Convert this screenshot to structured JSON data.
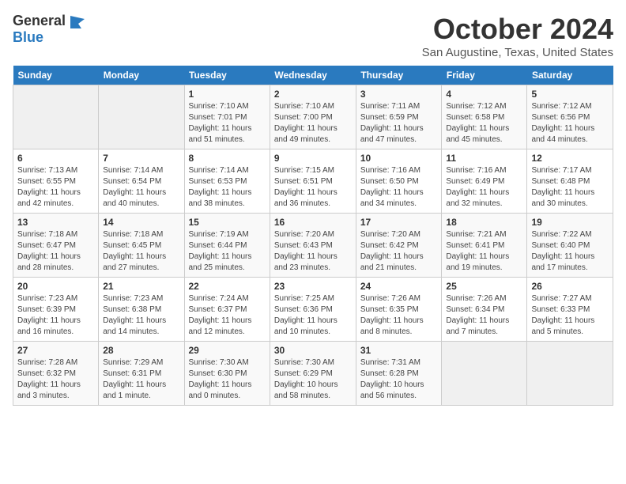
{
  "header": {
    "logo_general": "General",
    "logo_blue": "Blue",
    "title": "October 2024",
    "subtitle": "San Augustine, Texas, United States"
  },
  "days_of_week": [
    "Sunday",
    "Monday",
    "Tuesday",
    "Wednesday",
    "Thursday",
    "Friday",
    "Saturday"
  ],
  "weeks": [
    [
      {
        "day": "",
        "info": ""
      },
      {
        "day": "",
        "info": ""
      },
      {
        "day": "1",
        "info": "Sunrise: 7:10 AM\nSunset: 7:01 PM\nDaylight: 11 hours and 51 minutes."
      },
      {
        "day": "2",
        "info": "Sunrise: 7:10 AM\nSunset: 7:00 PM\nDaylight: 11 hours and 49 minutes."
      },
      {
        "day": "3",
        "info": "Sunrise: 7:11 AM\nSunset: 6:59 PM\nDaylight: 11 hours and 47 minutes."
      },
      {
        "day": "4",
        "info": "Sunrise: 7:12 AM\nSunset: 6:58 PM\nDaylight: 11 hours and 45 minutes."
      },
      {
        "day": "5",
        "info": "Sunrise: 7:12 AM\nSunset: 6:56 PM\nDaylight: 11 hours and 44 minutes."
      }
    ],
    [
      {
        "day": "6",
        "info": "Sunrise: 7:13 AM\nSunset: 6:55 PM\nDaylight: 11 hours and 42 minutes."
      },
      {
        "day": "7",
        "info": "Sunrise: 7:14 AM\nSunset: 6:54 PM\nDaylight: 11 hours and 40 minutes."
      },
      {
        "day": "8",
        "info": "Sunrise: 7:14 AM\nSunset: 6:53 PM\nDaylight: 11 hours and 38 minutes."
      },
      {
        "day": "9",
        "info": "Sunrise: 7:15 AM\nSunset: 6:51 PM\nDaylight: 11 hours and 36 minutes."
      },
      {
        "day": "10",
        "info": "Sunrise: 7:16 AM\nSunset: 6:50 PM\nDaylight: 11 hours and 34 minutes."
      },
      {
        "day": "11",
        "info": "Sunrise: 7:16 AM\nSunset: 6:49 PM\nDaylight: 11 hours and 32 minutes."
      },
      {
        "day": "12",
        "info": "Sunrise: 7:17 AM\nSunset: 6:48 PM\nDaylight: 11 hours and 30 minutes."
      }
    ],
    [
      {
        "day": "13",
        "info": "Sunrise: 7:18 AM\nSunset: 6:47 PM\nDaylight: 11 hours and 28 minutes."
      },
      {
        "day": "14",
        "info": "Sunrise: 7:18 AM\nSunset: 6:45 PM\nDaylight: 11 hours and 27 minutes."
      },
      {
        "day": "15",
        "info": "Sunrise: 7:19 AM\nSunset: 6:44 PM\nDaylight: 11 hours and 25 minutes."
      },
      {
        "day": "16",
        "info": "Sunrise: 7:20 AM\nSunset: 6:43 PM\nDaylight: 11 hours and 23 minutes."
      },
      {
        "day": "17",
        "info": "Sunrise: 7:20 AM\nSunset: 6:42 PM\nDaylight: 11 hours and 21 minutes."
      },
      {
        "day": "18",
        "info": "Sunrise: 7:21 AM\nSunset: 6:41 PM\nDaylight: 11 hours and 19 minutes."
      },
      {
        "day": "19",
        "info": "Sunrise: 7:22 AM\nSunset: 6:40 PM\nDaylight: 11 hours and 17 minutes."
      }
    ],
    [
      {
        "day": "20",
        "info": "Sunrise: 7:23 AM\nSunset: 6:39 PM\nDaylight: 11 hours and 16 minutes."
      },
      {
        "day": "21",
        "info": "Sunrise: 7:23 AM\nSunset: 6:38 PM\nDaylight: 11 hours and 14 minutes."
      },
      {
        "day": "22",
        "info": "Sunrise: 7:24 AM\nSunset: 6:37 PM\nDaylight: 11 hours and 12 minutes."
      },
      {
        "day": "23",
        "info": "Sunrise: 7:25 AM\nSunset: 6:36 PM\nDaylight: 11 hours and 10 minutes."
      },
      {
        "day": "24",
        "info": "Sunrise: 7:26 AM\nSunset: 6:35 PM\nDaylight: 11 hours and 8 minutes."
      },
      {
        "day": "25",
        "info": "Sunrise: 7:26 AM\nSunset: 6:34 PM\nDaylight: 11 hours and 7 minutes."
      },
      {
        "day": "26",
        "info": "Sunrise: 7:27 AM\nSunset: 6:33 PM\nDaylight: 11 hours and 5 minutes."
      }
    ],
    [
      {
        "day": "27",
        "info": "Sunrise: 7:28 AM\nSunset: 6:32 PM\nDaylight: 11 hours and 3 minutes."
      },
      {
        "day": "28",
        "info": "Sunrise: 7:29 AM\nSunset: 6:31 PM\nDaylight: 11 hours and 1 minute."
      },
      {
        "day": "29",
        "info": "Sunrise: 7:30 AM\nSunset: 6:30 PM\nDaylight: 11 hours and 0 minutes."
      },
      {
        "day": "30",
        "info": "Sunrise: 7:30 AM\nSunset: 6:29 PM\nDaylight: 10 hours and 58 minutes."
      },
      {
        "day": "31",
        "info": "Sunrise: 7:31 AM\nSunset: 6:28 PM\nDaylight: 10 hours and 56 minutes."
      },
      {
        "day": "",
        "info": ""
      },
      {
        "day": "",
        "info": ""
      }
    ]
  ]
}
